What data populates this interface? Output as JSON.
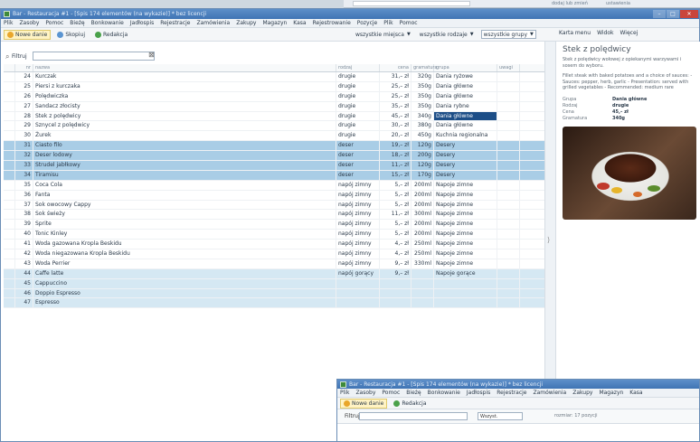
{
  "background_window": {
    "links": [
      "dodaj lub zmień",
      "ustawienia"
    ]
  },
  "window": {
    "title": "Bar - Restauracja #1 - [Spis 174 elementów (na wykazie)] * bez licencji",
    "menu": [
      "Plik",
      "Zasoby",
      "Pomoc",
      "Bieżę",
      "Bonkowanie",
      "Jadłospis",
      "Rejestracje",
      "Zamówienia",
      "Zakupy",
      "Magazyn",
      "Kasa",
      "Rejestrowanie",
      "Pozycje",
      "Plik",
      "Pomoc"
    ],
    "controls": {
      "minimize": "–",
      "maximize": "□",
      "close": "✕"
    }
  },
  "toolbar": {
    "new_label": "Nowe danie",
    "copy_label": "Skopiuj",
    "edit_label": "Redakcja",
    "filters": [
      "wszystkie miejsca",
      "wszystkie rodzaje",
      "wszystkie grupy"
    ],
    "right": [
      "Karta menu",
      "Widok",
      "Więcej"
    ]
  },
  "filter": {
    "label": "Filtruj",
    "value": ""
  },
  "table": {
    "columns": [
      "nr",
      "nazwa",
      "rodzaj",
      "cena",
      "gramatura",
      "grupa",
      "uwagi"
    ],
    "rows": [
      {
        "num": "24",
        "name": "Kurczak",
        "cat": "drugie",
        "price": "31,– zł",
        "qty": "320g",
        "grp": "Dania ryżowe"
      },
      {
        "num": "25",
        "name": "Piersi z kurczaka",
        "cat": "drugie",
        "price": "25,– zł",
        "qty": "350g",
        "grp": "Dania główne"
      },
      {
        "num": "26",
        "name": "Polędwiczka",
        "cat": "drugie",
        "price": "25,– zł",
        "qty": "350g",
        "grp": "Dania główne"
      },
      {
        "num": "27",
        "name": "Sandacz złocisty",
        "cat": "drugie",
        "price": "35,– zł",
        "qty": "350g",
        "grp": "Dania rybne"
      },
      {
        "num": "28",
        "name": "Stek z polędwicy",
        "cat": "drugie",
        "price": "45,– zł",
        "qty": "340g",
        "grp": "Dania główne",
        "hl": true
      },
      {
        "num": "29",
        "name": "Sznycel z polędwicy",
        "cat": "drugie",
        "price": "30,– zł",
        "qty": "380g",
        "grp": "Dania główne"
      },
      {
        "num": "30",
        "name": "Żurek",
        "cat": "drugie",
        "price": "20,– zł",
        "qty": "450g",
        "grp": "Kuchnia regionalna"
      },
      {
        "num": "31",
        "name": "Ciasto filo",
        "cat": "deser",
        "price": "19,– zł",
        "qty": "120g",
        "grp": "Desery",
        "sel": true
      },
      {
        "num": "32",
        "name": "Deser lodowy",
        "cat": "deser",
        "price": "18,– zł",
        "qty": "200g",
        "grp": "Desery",
        "sel": true
      },
      {
        "num": "33",
        "name": "Strudel jabłkowy",
        "cat": "deser",
        "price": "11,– zł",
        "qty": "120g",
        "grp": "Desery",
        "sel": true
      },
      {
        "num": "34",
        "name": "Tiramisu",
        "cat": "deser",
        "price": "15,– zł",
        "qty": "170g",
        "grp": "Desery",
        "sel": true
      },
      {
        "num": "35",
        "name": "Coca Cola",
        "cat": "napój zimny",
        "price": "5,– zł",
        "qty": "200ml",
        "grp": "Napoje zimne"
      },
      {
        "num": "36",
        "name": "Fanta",
        "cat": "napój zimny",
        "price": "5,– zł",
        "qty": "200ml",
        "grp": "Napoje zimne"
      },
      {
        "num": "37",
        "name": "Sok owocowy Cappy",
        "cat": "napój zimny",
        "price": "5,– zł",
        "qty": "200ml",
        "grp": "Napoje zimne"
      },
      {
        "num": "38",
        "name": "Sok świeży",
        "cat": "napój zimny",
        "price": "11,– zł",
        "qty": "300ml",
        "grp": "Napoje zimne"
      },
      {
        "num": "39",
        "name": "Sprite",
        "cat": "napój zimny",
        "price": "5,– zł",
        "qty": "200ml",
        "grp": "Napoje zimne"
      },
      {
        "num": "40",
        "name": "Tonic Kinley",
        "cat": "napój zimny",
        "price": "5,– zł",
        "qty": "200ml",
        "grp": "Napoje zimne"
      },
      {
        "num": "41",
        "name": "Woda gazowana Kropla Beskidu",
        "cat": "napój zimny",
        "price": "4,– zł",
        "qty": "250ml",
        "grp": "Napoje zimne"
      },
      {
        "num": "42",
        "name": "Woda niegazowana Kropla Beskidu",
        "cat": "napój zimny",
        "price": "4,– zł",
        "qty": "250ml",
        "grp": "Napoje zimne"
      },
      {
        "num": "43",
        "name": "Woda Perrier",
        "cat": "napój zimny",
        "price": "9,– zł",
        "qty": "330ml",
        "grp": "Napoje zimne"
      },
      {
        "num": "44",
        "name": "Caffe latte",
        "cat": "napój gorący",
        "price": "9,– zł",
        "qty": "",
        "grp": "Napoje gorące",
        "sel2": true
      },
      {
        "num": "45",
        "name": "Cappuccino",
        "cat": "",
        "price": "",
        "qty": "",
        "grp": "",
        "sel2": true
      },
      {
        "num": "46",
        "name": "Doppio Espresso",
        "cat": "",
        "price": "",
        "qty": "",
        "grp": "",
        "sel2": true
      },
      {
        "num": "47",
        "name": "Espresso",
        "cat": "",
        "price": "",
        "qty": "",
        "grp": "",
        "sel2": true
      }
    ]
  },
  "detail": {
    "title": "Stek z polędwicy",
    "description": "Stek z polędwicy wołowej z opiekanymi warzywami i sosem do wyboru.",
    "description_en": "Fillet steak with baked potatoes and a choice of sauces: - Sauces: pepper, herb, garlic - Presentation: served with grilled vegetables - Recommended: medium rare",
    "fields": [
      {
        "key": "Grupa",
        "value": "Dania główne"
      },
      {
        "key": "Rodzaj",
        "value": "drugie"
      },
      {
        "key": "Cena",
        "value": "45,– zł"
      },
      {
        "key": "Gramatura",
        "value": "340g"
      }
    ]
  },
  "window2": {
    "title": "Bar - Restauracja #1 - [Spis 174 elementów (na wykazie)] * bez licencji",
    "menu": [
      "Plik",
      "Zasoby",
      "Pomoc",
      "Bieżę",
      "Bonkowanie",
      "Jadłospis",
      "Rejestracje",
      "Zamówienia",
      "Zakupy",
      "Magazyn",
      "Kasa"
    ],
    "new_label": "Nowe danie",
    "edit_label": "Redakcja",
    "filter_label": "Filtruj",
    "select_value": "Wszyst.",
    "info": "rozmiar: 17 pozycji"
  }
}
